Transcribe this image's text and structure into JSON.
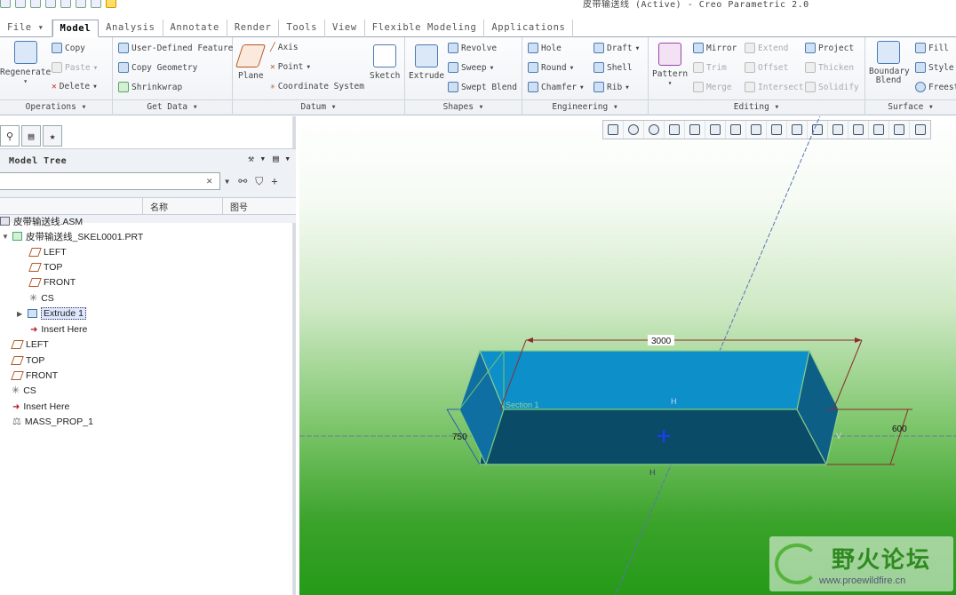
{
  "title_bar": {
    "text": "皮带输送线 (Active) - Creo Parametric 2.0"
  },
  "menu_tabs": [
    {
      "label": "File",
      "active": false
    },
    {
      "label": "Model",
      "active": true
    },
    {
      "label": "Analysis",
      "active": false
    },
    {
      "label": "Annotate",
      "active": false
    },
    {
      "label": "Render",
      "active": false
    },
    {
      "label": "Tools",
      "active": false
    },
    {
      "label": "View",
      "active": false
    },
    {
      "label": "Flexible Modeling",
      "active": false
    },
    {
      "label": "Applications",
      "active": false
    }
  ],
  "ribbon": {
    "operations": {
      "label": "Operations",
      "regenerate": "Regenerate",
      "copy": "Copy",
      "paste": "Paste",
      "delete": "Delete"
    },
    "get_data": {
      "label": "Get Data",
      "udf": "User-Defined Feature",
      "copy_geometry": "Copy Geometry",
      "shrinkwrap": "Shrinkwrap"
    },
    "datum": {
      "label": "Datum",
      "plane": "Plane",
      "axis": "Axis",
      "point": "Point",
      "csys": "Coordinate System",
      "sketch": "Sketch"
    },
    "shapes": {
      "label": "Shapes",
      "extrude": "Extrude",
      "revolve": "Revolve",
      "sweep": "Sweep",
      "swept_blend": "Swept Blend"
    },
    "engineering": {
      "label": "Engineering",
      "hole": "Hole",
      "round": "Round",
      "chamfer": "Chamfer",
      "draft": "Draft",
      "shell": "Shell",
      "rib": "Rib"
    },
    "editing": {
      "label": "Editing",
      "pattern": "Pattern",
      "mirror": "Mirror",
      "trim": "Trim",
      "merge": "Merge",
      "extend": "Extend",
      "offset": "Offset",
      "intersect": "Intersect",
      "project": "Project",
      "thicken": "Thicken",
      "solidify": "Solidify"
    },
    "surface": {
      "label": "Surface",
      "boundary_blend": "Boundary Blend",
      "fill": "Fill",
      "style": "Style",
      "freestyle": "Freest"
    }
  },
  "model_tree": {
    "title": "Model Tree",
    "columns": [
      "名称",
      "图号"
    ],
    "nodes": [
      {
        "label": "皮带输送线.ASM"
      },
      {
        "label": "皮带输送线_SKEL0001.PRT"
      },
      {
        "label": "LEFT"
      },
      {
        "label": "TOP"
      },
      {
        "label": "FRONT"
      },
      {
        "label": "CS"
      },
      {
        "label": "Extrude 1"
      },
      {
        "label": "Insert Here"
      },
      {
        "label": "LEFT"
      },
      {
        "label": "TOP"
      },
      {
        "label": "FRONT"
      },
      {
        "label": "CS"
      },
      {
        "label": "Insert Here"
      },
      {
        "label": "MASS_PROP_1"
      }
    ]
  },
  "scene": {
    "dims": {
      "length": "3000",
      "depth": "750",
      "height": "600"
    },
    "labels": {
      "section": "Section 1",
      "h": "H",
      "v": "V"
    }
  },
  "watermark": {
    "title": "野火论坛",
    "url": "www.proewildfire.cn"
  }
}
